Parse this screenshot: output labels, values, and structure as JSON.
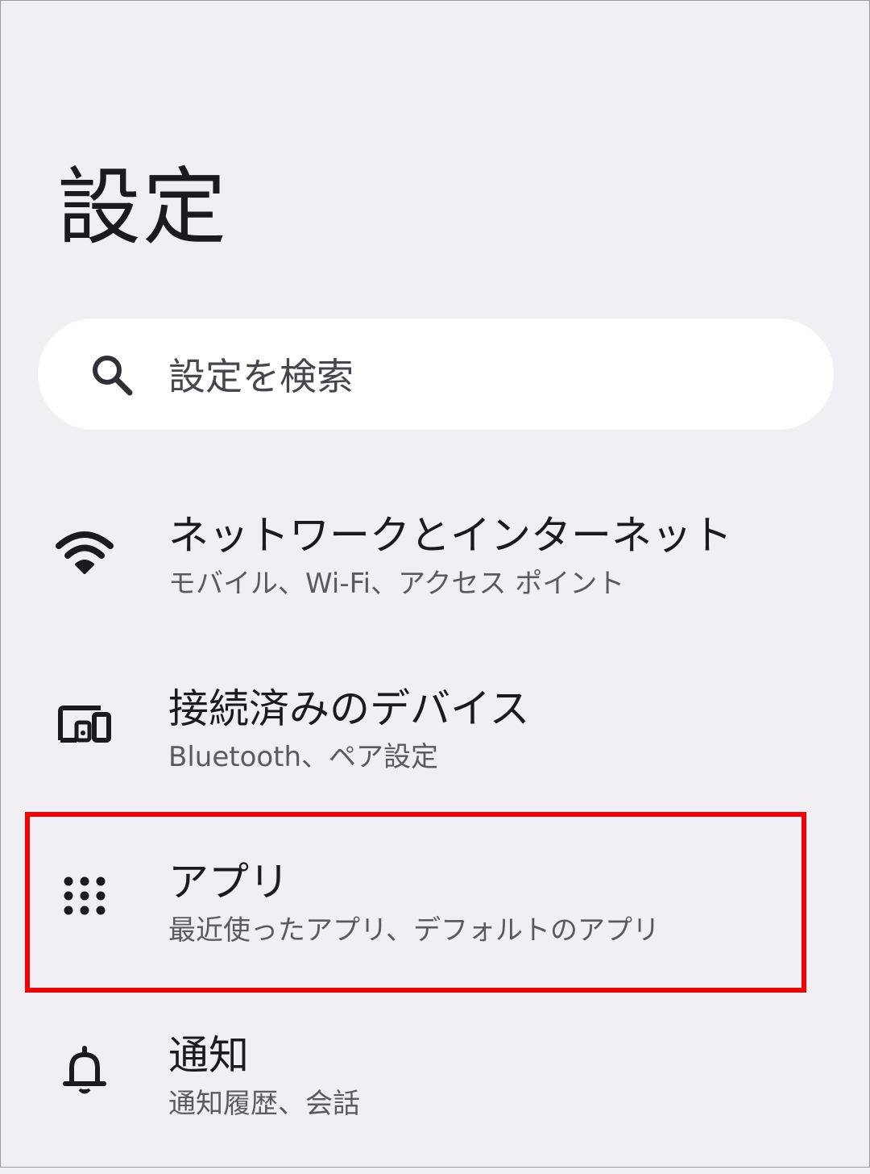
{
  "header": {
    "title": "設定"
  },
  "search": {
    "placeholder": "設定を検索",
    "icon": "search-icon"
  },
  "items": [
    {
      "title": "ネットワークとインターネット",
      "subtitle": "モバイル、Wi-Fi、アクセス ポイント",
      "icon": "wifi-icon"
    },
    {
      "title": "接続済みのデバイス",
      "subtitle": "Bluetooth、ペア設定",
      "icon": "connected-devices-icon"
    },
    {
      "title": "アプリ",
      "subtitle": "最近使ったアプリ、デフォルトのアプリ",
      "icon": "apps-grid-icon",
      "highlighted": true
    },
    {
      "title": "通知",
      "subtitle": "通知履歴、会話",
      "icon": "bell-icon"
    }
  ],
  "colors": {
    "background": "#f1eff4",
    "highlight": "#f00000",
    "text_primary": "#1b1b1f",
    "text_secondary": "#5a5a62"
  }
}
